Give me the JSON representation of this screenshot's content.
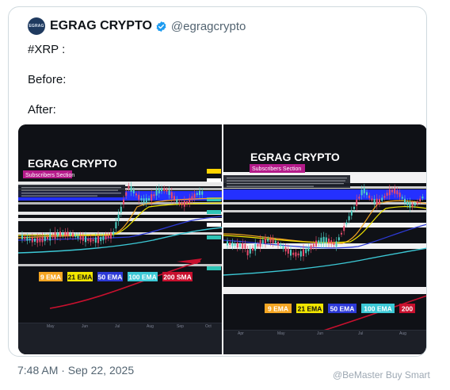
{
  "tweet": {
    "display_name": "EGRAG CRYPTO",
    "handle": "@egragcrypto",
    "verified_icon": "verified-badge-icon",
    "avatar_text": "EGRAG",
    "lines": [
      "#XRP :",
      "Before:",
      "After:"
    ],
    "timestamp": "7:48 AM · Sep 22, 2025"
  },
  "charts": {
    "before": {
      "title": "EGRAG CRYPTO",
      "section": "Subscribers Section",
      "ema_labels": [
        "9 EMA",
        "21 EMA",
        "50 EMA",
        "100 EMA",
        "200 SMA"
      ],
      "months": [
        "May",
        "Jun",
        "Jul",
        "Aug",
        "Sep",
        "Oct"
      ]
    },
    "after": {
      "title": "EGRAG CRYPTO",
      "section": "Subscribers Section",
      "ema_labels": [
        "9 EMA",
        "21 EMA",
        "50 EMA",
        "100 EMA",
        "200"
      ],
      "months": [
        "Apr",
        "May",
        "Jun",
        "Jul",
        "Aug"
      ]
    },
    "colors": {
      "ema9": "#f5a623",
      "ema21": "#f2e600",
      "ema50": "#2d3ad8",
      "ema100": "#3cc9d6",
      "sma200": "#c8102e",
      "band_blue": "#2430ff",
      "up_candle": "#4fd1c5",
      "down_candle": "#e84b6b"
    }
  },
  "watermark": "@BeMaster Buy Smart"
}
